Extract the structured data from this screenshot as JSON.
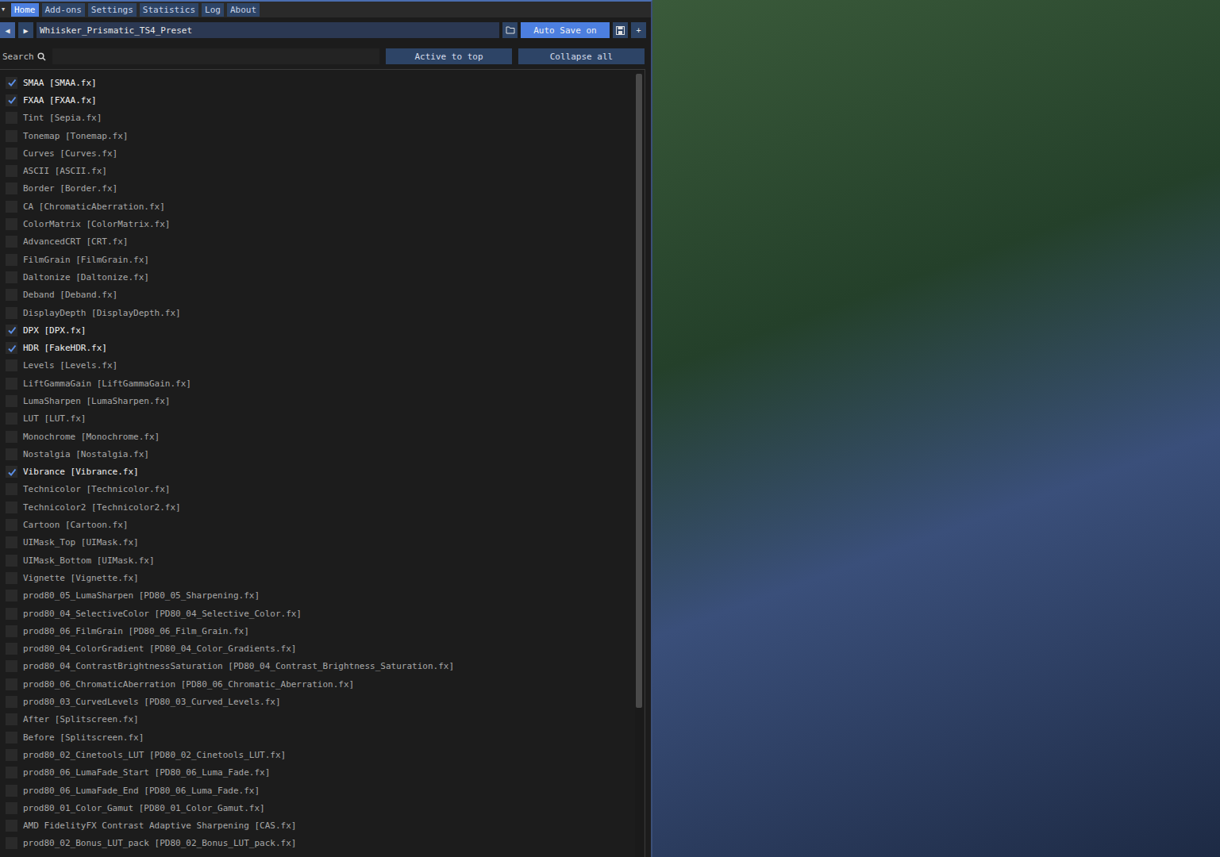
{
  "menu": {
    "toggle": "▼",
    "tabs": [
      {
        "label": "Home",
        "selected": true
      },
      {
        "label": "Add-ons",
        "selected": false
      },
      {
        "label": "Settings",
        "selected": false
      },
      {
        "label": "Statistics",
        "selected": false
      },
      {
        "label": "Log",
        "selected": false
      },
      {
        "label": "About",
        "selected": false
      }
    ]
  },
  "preset": {
    "prev": "◀",
    "next": "▶",
    "path": "Whiisker_Prismatic_TS4_Preset",
    "auto_save": {
      "label": "Auto Save on",
      "on": true
    },
    "add": "+"
  },
  "search": {
    "label": "Search",
    "value": ""
  },
  "list_buttons": [
    "Active to top",
    "Collapse all"
  ],
  "scrollbar": {
    "level": 0.81
  },
  "effects": [
    {
      "label": "SMAA [SMAA.fx]",
      "checked": true
    },
    {
      "label": "FXAA [FXAA.fx]",
      "checked": true
    },
    {
      "label": "Tint [Sepia.fx]",
      "checked": false
    },
    {
      "label": "Tonemap [Tonemap.fx]",
      "checked": false
    },
    {
      "label": "Curves [Curves.fx]",
      "checked": false
    },
    {
      "label": "ASCII [ASCII.fx]",
      "checked": false
    },
    {
      "label": "Border [Border.fx]",
      "checked": false
    },
    {
      "label": "CA [ChromaticAberration.fx]",
      "checked": false
    },
    {
      "label": "ColorMatrix [ColorMatrix.fx]",
      "checked": false
    },
    {
      "label": "AdvancedCRT [CRT.fx]",
      "checked": false
    },
    {
      "label": "FilmGrain [FilmGrain.fx]",
      "checked": false
    },
    {
      "label": "Daltonize [Daltonize.fx]",
      "checked": false
    },
    {
      "label": "Deband [Deband.fx]",
      "checked": false
    },
    {
      "label": "DisplayDepth [DisplayDepth.fx]",
      "checked": false
    },
    {
      "label": "DPX [DPX.fx]",
      "checked": true
    },
    {
      "label": "HDR [FakeHDR.fx]",
      "checked": true
    },
    {
      "label": "Levels [Levels.fx]",
      "checked": false
    },
    {
      "label": "LiftGammaGain [LiftGammaGain.fx]",
      "checked": false
    },
    {
      "label": "LumaSharpen [LumaSharpen.fx]",
      "checked": false
    },
    {
      "label": "LUT [LUT.fx]",
      "checked": false
    },
    {
      "label": "Monochrome [Monochrome.fx]",
      "checked": false
    },
    {
      "label": "Nostalgia [Nostalgia.fx]",
      "checked": false
    },
    {
      "label": "Vibrance [Vibrance.fx]",
      "checked": true
    },
    {
      "label": "Technicolor [Technicolor.fx]",
      "checked": false
    },
    {
      "label": "Technicolor2 [Technicolor2.fx]",
      "checked": false
    },
    {
      "label": "Cartoon [Cartoon.fx]",
      "checked": false
    },
    {
      "label": "UIMask_Top [UIMask.fx]",
      "checked": false
    },
    {
      "label": "UIMask_Bottom [UIMask.fx]",
      "checked": false
    },
    {
      "label": "Vignette [Vignette.fx]",
      "checked": false
    },
    {
      "label": "prod80_05_LumaSharpen [PD80_05_Sharpening.fx]",
      "checked": false
    },
    {
      "label": "prod80_04_SelectiveColor [PD80_04_Selective_Color.fx]",
      "checked": false
    },
    {
      "label": "prod80_06_FilmGrain [PD80_06_Film_Grain.fx]",
      "checked": false
    },
    {
      "label": "prod80_04_ColorGradient [PD80_04_Color_Gradients.fx]",
      "checked": false
    },
    {
      "label": "prod80_04_ContrastBrightnessSaturation [PD80_04_Contrast_Brightness_Saturation.fx]",
      "checked": false
    },
    {
      "label": "prod80_06_ChromaticAberration [PD80_06_Chromatic_Aberration.fx]",
      "checked": false
    },
    {
      "label": "prod80_03_CurvedLevels [PD80_03_Curved_Levels.fx]",
      "checked": false
    },
    {
      "label": "After [Splitscreen.fx]",
      "checked": false
    },
    {
      "label": "Before [Splitscreen.fx]",
      "checked": false
    },
    {
      "label": "prod80_02_Cinetools_LUT [PD80_02_Cinetools_LUT.fx]",
      "checked": false
    },
    {
      "label": "prod80_06_LumaFade_Start [PD80_06_Luma_Fade.fx]",
      "checked": false
    },
    {
      "label": "prod80_06_LumaFade_End [PD80_06_Luma_Fade.fx]",
      "checked": false
    },
    {
      "label": "prod80_01_Color_Gamut [PD80_01_Color_Gamut.fx]",
      "checked": false
    },
    {
      "label": "AMD FidelityFX Contrast Adaptive Sharpening [CAS.fx]",
      "checked": false
    },
    {
      "label": "prod80_02_Bonus_LUT_pack [PD80_02_Bonus_LUT_pack.fx]",
      "checked": false
    }
  ]
}
